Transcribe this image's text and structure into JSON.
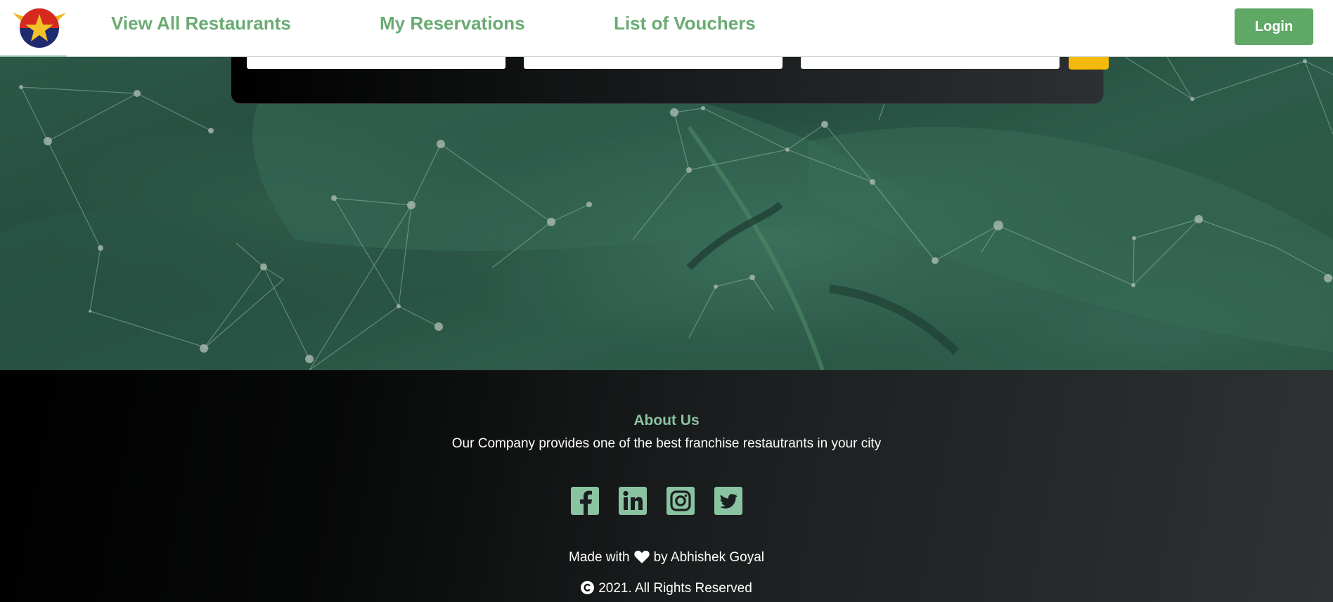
{
  "navbar": {
    "logo_icon": "shield-star-logo-icon",
    "links": [
      {
        "label": "View All Restaurants"
      },
      {
        "label": "My Reservations"
      },
      {
        "label": "List of Vouchers"
      }
    ],
    "login_label": "Login",
    "link_color": "#69ab73",
    "login_color": "#5fa866"
  },
  "search": {
    "fields": [
      {
        "placeholder": ""
      },
      {
        "placeholder": ""
      },
      {
        "placeholder": ""
      }
    ],
    "button_color": "#f4b90b"
  },
  "footer": {
    "about_title": "About Us",
    "about_text": "Our Company provides one of the best franchise restautrants in your city",
    "social": [
      {
        "icon": "facebook-icon"
      },
      {
        "icon": "linkedin-icon"
      },
      {
        "icon": "instagram-icon"
      },
      {
        "icon": "twitter-icon"
      }
    ],
    "made_with_prefix": "Made with",
    "heart_icon": "heart-icon",
    "made_with_suffix": "by Abhishek Goyal",
    "copyright_icon": "copyright-icon",
    "copyright_text": "2021. All Rights Reserved",
    "accent_color": "#8ac3a2"
  }
}
